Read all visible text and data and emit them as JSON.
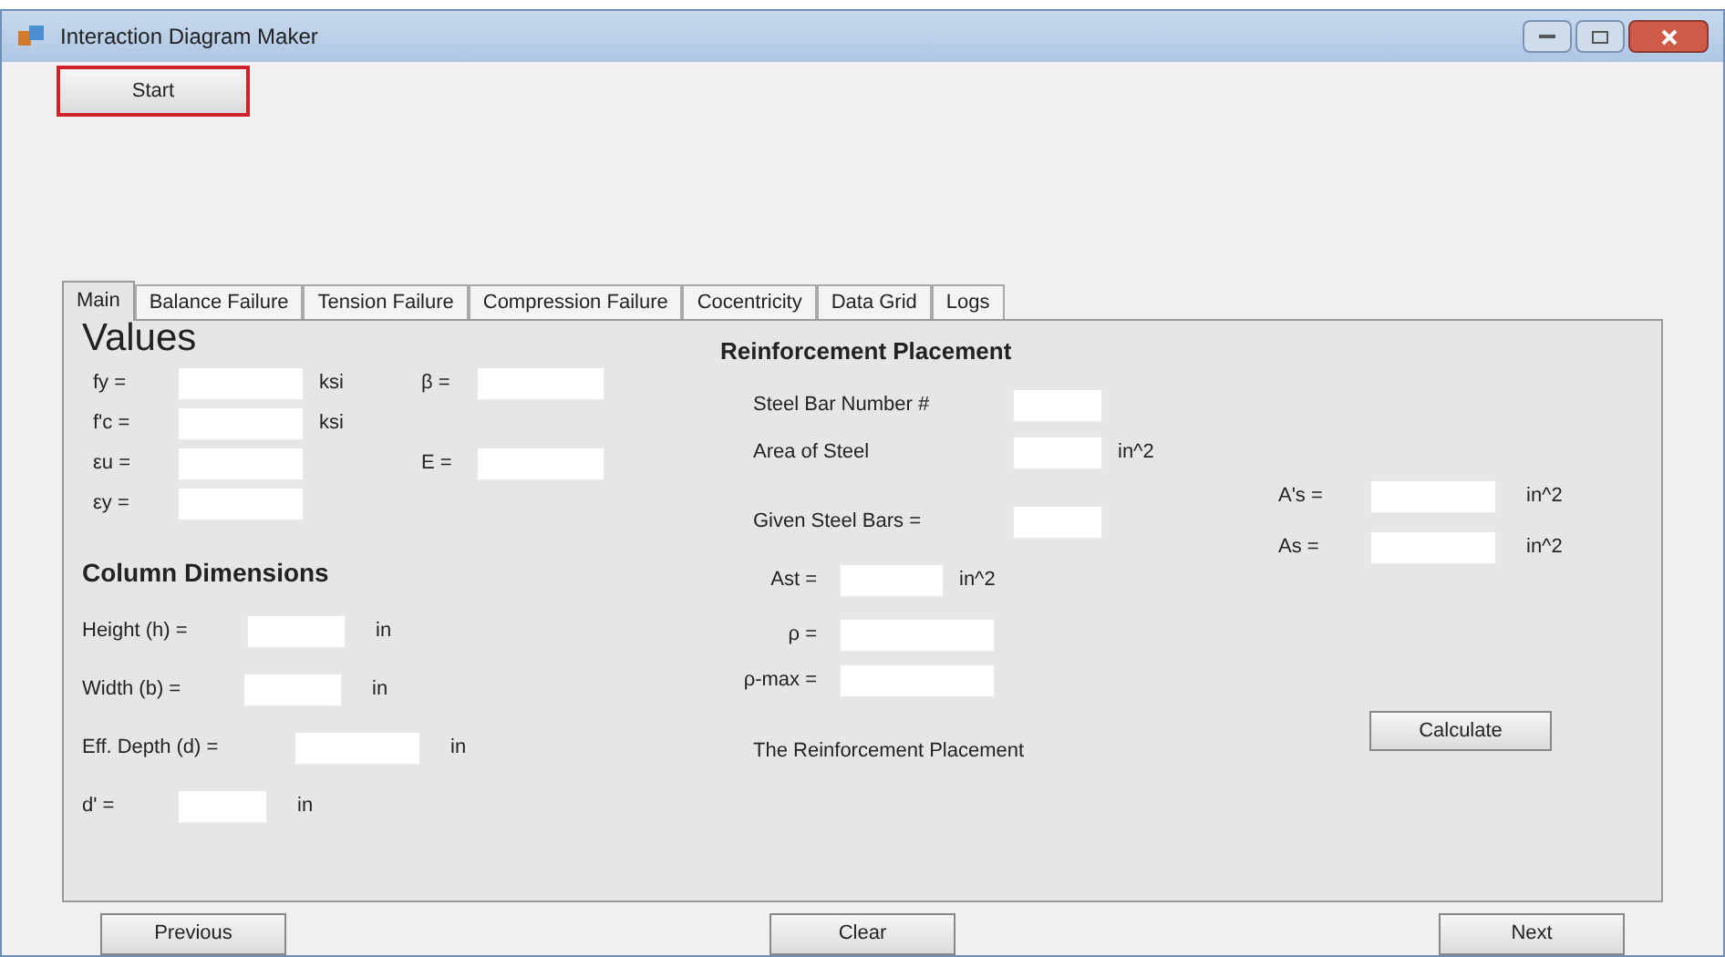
{
  "window": {
    "title": "Interaction Diagram Maker"
  },
  "start_button": "Start",
  "tabs": [
    {
      "label": "Main",
      "selected": true
    },
    {
      "label": "Balance Failure",
      "selected": false
    },
    {
      "label": "Tension Failure",
      "selected": false
    },
    {
      "label": "Compression Failure",
      "selected": false
    },
    {
      "label": "Cocentricity",
      "selected": false
    },
    {
      "label": "Data Grid",
      "selected": false
    },
    {
      "label": "Logs",
      "selected": false
    }
  ],
  "values": {
    "heading": "Values",
    "rows": [
      {
        "left": {
          "label": "fy =",
          "unit": "ksi"
        },
        "right": {
          "label": "β ="
        }
      },
      {
        "left": {
          "label": "f'c =",
          "unit": "ksi"
        }
      },
      {
        "left": {
          "label": "εu ="
        },
        "right": {
          "label": "E ="
        }
      },
      {
        "left": {
          "label": "εy ="
        }
      }
    ]
  },
  "column_dimensions": {
    "heading": "Column Dimensions",
    "fields": [
      {
        "label": "Height (h) =",
        "unit": "in"
      },
      {
        "label": "Width (b) =",
        "unit": "in"
      },
      {
        "label": "Eff. Depth (d) =",
        "unit": "in"
      },
      {
        "label": "d' =",
        "unit": "in"
      }
    ]
  },
  "reinforcement": {
    "heading": "Reinforcement Placement",
    "fields": [
      {
        "label": "Steel Bar Number #"
      },
      {
        "label": "Area of Steel",
        "unit": "in^2"
      },
      {
        "label": "Given Steel Bars ="
      }
    ],
    "ratio_fields": [
      {
        "label": "Ast =",
        "unit": "in^2"
      },
      {
        "label": "ρ ="
      },
      {
        "label": "ρ-max ="
      }
    ],
    "note": "The Reinforcement Placement"
  },
  "steel_areas": [
    {
      "label": "A's =",
      "unit": "in^2"
    },
    {
      "label": "As =",
      "unit": "in^2"
    }
  ],
  "calculate_button": "Calculate",
  "footer_buttons": [
    "Previous",
    "Clear",
    "Next"
  ]
}
